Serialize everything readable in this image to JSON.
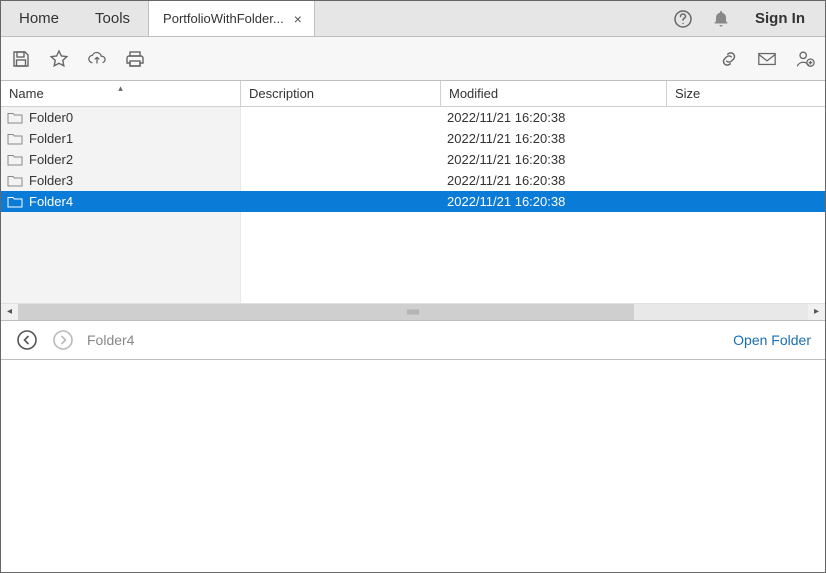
{
  "tabs": {
    "home": "Home",
    "tools": "Tools",
    "doc": "PortfolioWithFolder...",
    "sign_in": "Sign In"
  },
  "columns": {
    "name": "Name",
    "desc": "Description",
    "mod": "Modified",
    "size": "Size"
  },
  "rows": [
    {
      "name": "Folder0",
      "desc": "",
      "mod": "2022/11/21 16:20:38",
      "size": "",
      "selected": false
    },
    {
      "name": "Folder1",
      "desc": "",
      "mod": "2022/11/21 16:20:38",
      "size": "",
      "selected": false
    },
    {
      "name": "Folder2",
      "desc": "",
      "mod": "2022/11/21 16:20:38",
      "size": "",
      "selected": false
    },
    {
      "name": "Folder3",
      "desc": "",
      "mod": "2022/11/21 16:20:38",
      "size": "",
      "selected": false
    },
    {
      "name": "Folder4",
      "desc": "",
      "mod": "2022/11/21 16:20:38",
      "size": "",
      "selected": true
    }
  ],
  "nav": {
    "breadcrumb": "Folder4",
    "open": "Open Folder"
  }
}
